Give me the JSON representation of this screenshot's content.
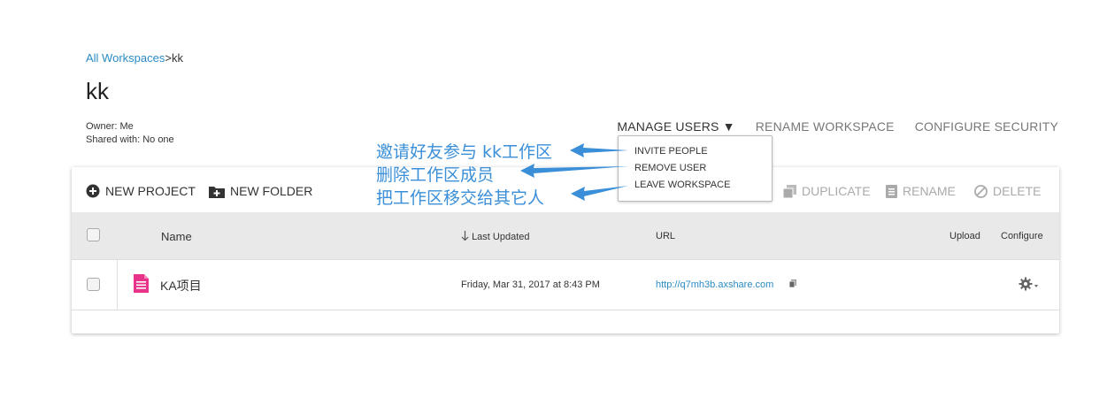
{
  "breadcrumb": {
    "root": "All Workspaces",
    "separator": ">",
    "current": "kk"
  },
  "workspace": {
    "title": "kk",
    "owner": "Owner: Me",
    "shared": "Shared with: No one"
  },
  "top_actions": {
    "manage_users": "MANAGE USERS ▼",
    "rename_workspace": "RENAME WORKSPACE",
    "configure_security": "CONFIGURE SECURITY"
  },
  "toolbar": {
    "new_project": "NEW PROJECT",
    "new_folder": "NEW FOLDER",
    "duplicate": "DUPLICATE",
    "rename": "RENAME",
    "delete": "DELETE"
  },
  "table": {
    "headers": {
      "name": "Name",
      "last_updated": "Last Updated",
      "url": "URL",
      "upload": "Upload",
      "configure": "Configure"
    },
    "rows": [
      {
        "name": "KA项目",
        "last_updated": "Friday, Mar 31, 2017 at 8:43 PM",
        "url": "http://q7mh3b.axshare.com"
      }
    ]
  },
  "manage_users_menu": {
    "items": [
      "INVITE PEOPLE",
      "REMOVE USER",
      "LEAVE WORKSPACE"
    ]
  },
  "annotations": [
    "邀请好友参与 kk工作区",
    "删除工作区成员",
    "把工作区移交给其它人"
  ],
  "colors": {
    "link": "#2a8bc4",
    "annotation": "#3a8fd8",
    "file_icon": "#e8338a",
    "header_bg": "#e9e9e9"
  },
  "icons": [
    "plus-circle-icon",
    "folder-plus-icon",
    "duplicate-icon",
    "rename-icon",
    "delete-icon",
    "sort-down-arrow-icon",
    "file-icon",
    "copy-icon",
    "gear-icon"
  ]
}
